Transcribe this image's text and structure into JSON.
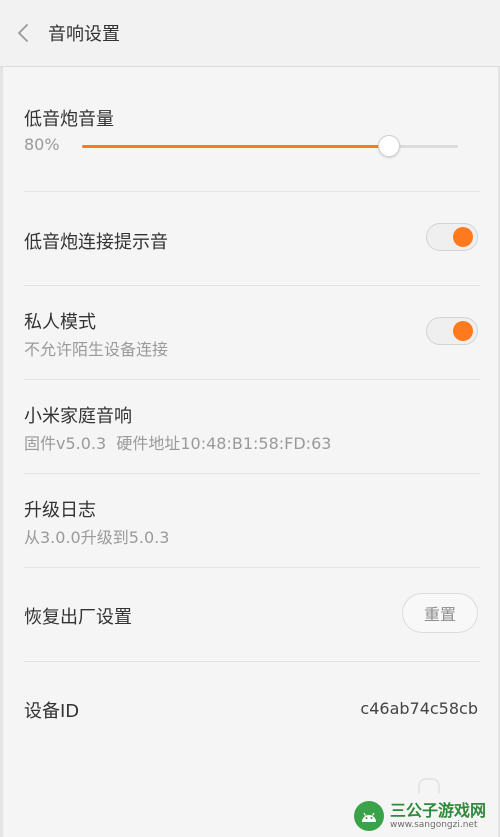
{
  "header": {
    "back_icon": "chevron-left-icon",
    "title": "音响设置"
  },
  "subwoofer_volume": {
    "title": "低音炮音量",
    "value_label": "80%",
    "level": 0.815
  },
  "subwoofer_connect_sound": {
    "title": "低音炮连接提示音",
    "enabled": true
  },
  "private_mode": {
    "title": "私人模式",
    "subtitle": "不允许陌生设备连接",
    "enabled": true
  },
  "home_speaker": {
    "title": "小米家庭音响",
    "subtitle": "固件v5.0.3  硬件地址10:48:B1:58:FD:63"
  },
  "upgrade_log": {
    "title": "升级日志",
    "subtitle": "从3.0.0升级到5.0.3"
  },
  "factory_reset": {
    "title": "恢复出厂设置",
    "button_label": "重置"
  },
  "device_id": {
    "title": "设备ID",
    "value": "c46ab74c58cb"
  },
  "watermark": {
    "title": "三公子游戏网",
    "url": "www.sangongzi.net"
  },
  "colors": {
    "accent": "#ff7a1f",
    "text": "#333333",
    "subtext": "#9a9a9a",
    "background": "#f5f5f5"
  }
}
